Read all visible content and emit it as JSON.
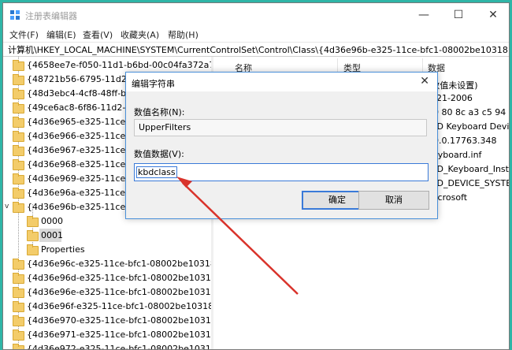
{
  "window": {
    "title": "注册表编辑器",
    "minimize": "—",
    "maximize": "☐",
    "close": "✕"
  },
  "menu": [
    "文件(F)",
    "编辑(E)",
    "查看(V)",
    "收藏夹(A)",
    "帮助(H)"
  ],
  "address": "计算机\\HKEY_LOCAL_MACHINE\\SYSTEM\\CurrentControlSet\\Control\\Class\\{4d36e96b-e325-11ce-bfc1-08002be10318}\\0001",
  "tree": {
    "top_items": [
      "{4658ee7e-f050-11d1-b6bd-00c04fa372a7}",
      "{48721b56-6795-11d2-b",
      "{48d3ebc4-4cf8-48ff-b86",
      "{49ce6ac8-6f86-11d2-b1",
      "{4d36e965-e325-11ce-bfc",
      "{4d36e966-e325-11ce-bfc",
      "{4d36e967-e325-11ce-bfc",
      "{4d36e968-e325-11ce-bfc",
      "{4d36e969-e325-11ce-bfc",
      "{4d36e96a-e325-11ce-bfc",
      "{4d36e96b-e325-11ce-bfc"
    ],
    "children": [
      "0000",
      "0001",
      "Properties"
    ],
    "bottom_items": [
      "{4d36e96c-e325-11ce-bfc1-08002be10318}",
      "{4d36e96d-e325-11ce-bfc1-08002be10318}",
      "{4d36e96e-e325-11ce-bfc1-08002be10318}",
      "{4d36e96f-e325-11ce-bfc1-08002be10318}",
      "{4d36e970-e325-11ce-bfc1-08002be10318}",
      "{4d36e971-e325-11ce-bfc1-08002be10318}",
      "{4d36e972-e325-11ce-bfc1-08002be10318}"
    ]
  },
  "columns": {
    "name": "名称",
    "type": "类型",
    "data": "数据"
  },
  "data_values": [
    "(数值未设置)",
    "6-21-2006",
    "00 80 8c a3 c5 94 c",
    "HID Keyboard Devic",
    "10.0.17763.348",
    "keyboard.inf",
    "HID_Keyboard_Inst.N",
    "HID_DEVICE_SYSTEM",
    "Microsoft"
  ],
  "dialog": {
    "title": "编辑字符串",
    "close": "✕",
    "name_label": "数值名称(N):",
    "name_value": "UpperFilters",
    "data_label": "数值数据(V):",
    "data_value": "kbdclass",
    "ok": "确定",
    "cancel": "取消"
  },
  "colors": {
    "accent": "#3a7ad8",
    "arrow": "#d9332b",
    "folder": "#f3cc6a",
    "desktop": "#2fb5a7"
  }
}
